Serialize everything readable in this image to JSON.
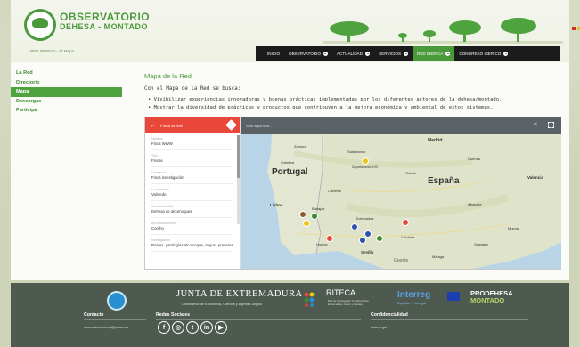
{
  "header": {
    "logo_title": "OBSERVATORIO",
    "logo_subtitle": "DEHESA - MONTADO",
    "breadcrumb": "RED IBÉRICA › El Mapa"
  },
  "nav": {
    "items": [
      {
        "label": "Inicio",
        "dropdown": false,
        "active": false
      },
      {
        "label": "Observatorio",
        "dropdown": true,
        "active": false
      },
      {
        "label": "Actualidad",
        "dropdown": true,
        "active": false
      },
      {
        "label": "Servicios",
        "dropdown": true,
        "active": false
      },
      {
        "label": "Red Ibérica",
        "dropdown": true,
        "active": true
      },
      {
        "label": "Congreso Ibérico",
        "dropdown": true,
        "active": false
      }
    ]
  },
  "sidebar": {
    "items": [
      {
        "label": "La Red",
        "active": false
      },
      {
        "label": "Directorio",
        "active": false
      },
      {
        "label": "Mapa",
        "active": true
      },
      {
        "label": "Descargas",
        "active": false
      },
      {
        "label": "Participa",
        "active": false
      }
    ]
  },
  "main": {
    "title": "Mapa de la Red",
    "intro": "Con el Mapa de la Red se busca:",
    "bullets": [
      "Visibilizar experiencias innovadoras y buenas prácticas implementadas por los diferentes actores de la dehesa/montado.",
      "Mostrar la diversidad de prácticas y productos que contribuyen a la mejora económica y ambiental de estos sistemas."
    ]
  },
  "map_panel": {
    "title": "Finca WWW",
    "fields": [
      {
        "label": "Nombre",
        "value": "Finca WWW"
      },
      {
        "label": "Tipo",
        "value": "Fincas"
      },
      {
        "label": "Categoría",
        "value": "Finca investigación"
      },
      {
        "label": "Localización",
        "value": "Valverde"
      },
      {
        "label": "Condición/título",
        "value": "Dehesa de alcornoques"
      },
      {
        "label": "Aprovechamiento",
        "value": "Corcho"
      },
      {
        "label": "Investigación",
        "value": "Raíces, patologías alcornoque, mejora praderas"
      }
    ]
  },
  "map": {
    "topbar_text": "Vista mapa varia...",
    "countries": [
      "Portugal",
      "España"
    ],
    "cities": [
      "Madrid",
      "Valencia",
      "Lisboa",
      "Sevilla",
      "Córdoba",
      "Murcia",
      "Salamanca",
      "Zamora",
      "Coimbra",
      "Toledo",
      "Cuenca",
      "Albacete",
      "Granada",
      "Málaga",
      "Badajoz",
      "Cáceres",
      "Departamento XXX",
      "Extremadura",
      "Huelva"
    ],
    "attribution": "Google",
    "marker_colors": {
      "red": "#e8473a",
      "green": "#3c8a2e",
      "blue": "#2d4fb0",
      "yellow": "#f0c419",
      "brown": "#8b5a2b"
    }
  },
  "footer": {
    "junta_title": "JUNTA DE EXTREMADURA",
    "junta_sub": "Consejería de Economía, Ciencia y Agenda Digital",
    "riteca_title": "RITECA",
    "riteca_sub": "Red de Investigación Transfronteriza Extremadura, Centro y Alentejo",
    "interreg_title": "Interreg",
    "interreg_sub": "España - Portugal",
    "prodehesa_title": "PRODEHESA",
    "prodehesa_sub": "MONTADO",
    "contact_heading": "Contacto",
    "contact_email": "observatoriodehesa@juntaex.es",
    "social_heading": "Redes Sociales",
    "social_icons": [
      "f",
      "◎",
      "t",
      "in",
      "▶"
    ],
    "conf_heading": "Confidencialidad",
    "conf_link": "Aviso Legal"
  }
}
